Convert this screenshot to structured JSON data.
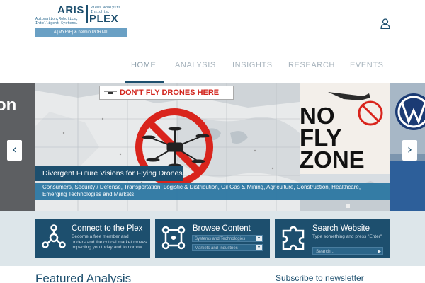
{
  "logo": {
    "word1": "ARIS",
    "word2": "PLEX",
    "tagline_right": "Views.Analysis. Insights.",
    "tagline_left": "Automation,Robotics, Intelligent Systems.",
    "portal": "A |MYRıE| & nelmio PORTAL",
    "brand_color": "#1d4f6e",
    "accent_color": "#6aa0c4"
  },
  "header": {
    "user_icon": "user-icon"
  },
  "nav": {
    "items": [
      {
        "label": "HOME",
        "active": true
      },
      {
        "label": "ANALYSIS",
        "active": false
      },
      {
        "label": "INSIGHTS",
        "active": false
      },
      {
        "label": "RESEARCH",
        "active": false
      },
      {
        "label": "EVENTS",
        "active": false
      }
    ]
  },
  "carousel": {
    "left_partial_text": "on",
    "banner_text": "DON'T FLY DRONES HERE",
    "slide_title": "Divergent Future Visions for Flying Drones",
    "slide_categories": "Consumers, Security / Defense, Transportation, Logistic & Distribution, Oil Gas & Mining, Agriculture, Construction, Healthcare, Emerging Technologies and Markets",
    "nofly_lines": [
      "NO",
      "FLY",
      "ZONE"
    ],
    "prev_icon": "chevron-left-icon",
    "next_icon": "chevron-right-icon",
    "prev_glyph": "‹",
    "next_glyph": "›"
  },
  "tiles": {
    "connect": {
      "title": "Connect to the Plex",
      "description": "Become a free member and understand the critical market moves impacting you today and tomorrow",
      "icon": "network-icon"
    },
    "browse": {
      "title": "Browse Content",
      "select1": "Systems and Technologies",
      "select2": "Markets and Industries",
      "icon": "nodes-icon",
      "select_arrow": "▾"
    },
    "search": {
      "title": "Search Website",
      "description": "Type something and press \"Enter\"",
      "placeholder": "Search...",
      "go_glyph": "▶",
      "icon": "puzzle-icon"
    }
  },
  "sections": {
    "featured": "Featured Analysis",
    "subscribe": "Subscribe to newsletter"
  }
}
